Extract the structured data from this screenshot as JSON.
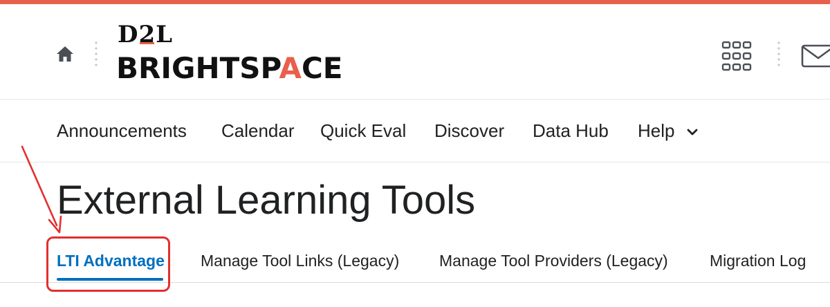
{
  "colors": {
    "accent_bar": "#e8604c",
    "active_tab": "#006fbf",
    "annotation": "#e22f2f",
    "text": "#202122"
  },
  "header": {
    "logo_top": "D2L",
    "logo_bottom": "BRIGHTSPACE",
    "home_icon": "home-icon",
    "apps_icon": "waffle-icon",
    "messages_icon": "mail-icon"
  },
  "nav": {
    "items": [
      {
        "label": "Announcements"
      },
      {
        "label": "Calendar"
      },
      {
        "label": "Quick Eval"
      },
      {
        "label": "Discover"
      },
      {
        "label": "Data Hub"
      },
      {
        "label": "Help",
        "has_dropdown": true
      }
    ]
  },
  "page": {
    "title": "External Learning Tools"
  },
  "tabs": [
    {
      "label": "LTI Advantage",
      "active": true
    },
    {
      "label": "Manage Tool Links (Legacy)",
      "active": false
    },
    {
      "label": "Manage Tool Providers (Legacy)",
      "active": false
    },
    {
      "label": "Migration Log",
      "active": false
    }
  ]
}
